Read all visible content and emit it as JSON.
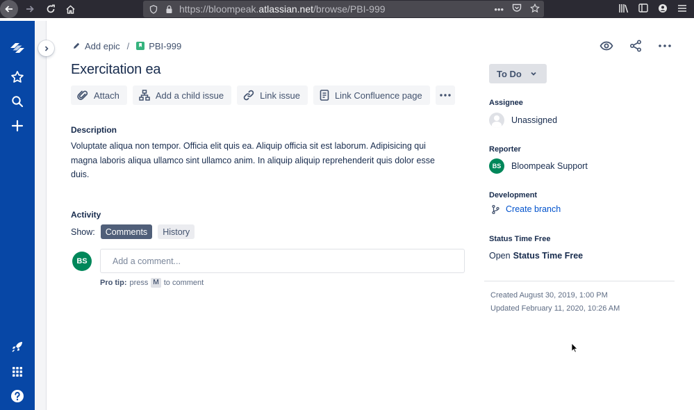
{
  "browser": {
    "url_prefix": "https://bloompeak.",
    "url_domain": "atlassian.net",
    "url_path": "/browse/PBI-999"
  },
  "breadcrumb": {
    "epic_label": "Add epic",
    "separator": "/",
    "issue_key": "PBI-999"
  },
  "issue": {
    "title": "Exercitation ea"
  },
  "toolbar": {
    "attach_label": "Attach",
    "child_issue_label": "Add a child issue",
    "link_issue_label": "Link issue",
    "confluence_label": "Link Confluence page"
  },
  "description": {
    "heading": "Description",
    "text": "Voluptate aliqua non tempor. Officia elit quis ea. Aliquip officia sit est laborum. Adipisicing qui magna laboris aliqua ullamco sint ullamco anim. In aliquip aliquip reprehenderit quis dolor esse duis."
  },
  "activity": {
    "heading": "Activity",
    "show_label": "Show:",
    "tabs": [
      {
        "label": "Comments",
        "active": true
      },
      {
        "label": "History",
        "active": false
      }
    ],
    "user_initials": "BS",
    "comment_placeholder": "Add a comment...",
    "pro_tip_bold": "Pro tip:",
    "pro_tip_press": "press",
    "pro_tip_key": "M",
    "pro_tip_suffix": "to comment"
  },
  "sidebar_panel": {
    "status_label": "To Do",
    "assignee_heading": "Assignee",
    "assignee_value": "Unassigned",
    "reporter_heading": "Reporter",
    "reporter_initials": "BS",
    "reporter_value": "Bloompeak Support",
    "development_heading": "Development",
    "create_branch_label": "Create branch",
    "status_time_heading": "Status Time Free",
    "status_time_open": "Open",
    "status_time_link": "Status Time Free",
    "created": "Created August 30, 2019, 1:00 PM",
    "updated": "Updated February 11, 2020, 10:26 AM"
  },
  "colors": {
    "global_nav": "#0747A6",
    "avatar_green": "#00875A",
    "active_pill": "#505F79",
    "link_blue": "#0052CC"
  }
}
